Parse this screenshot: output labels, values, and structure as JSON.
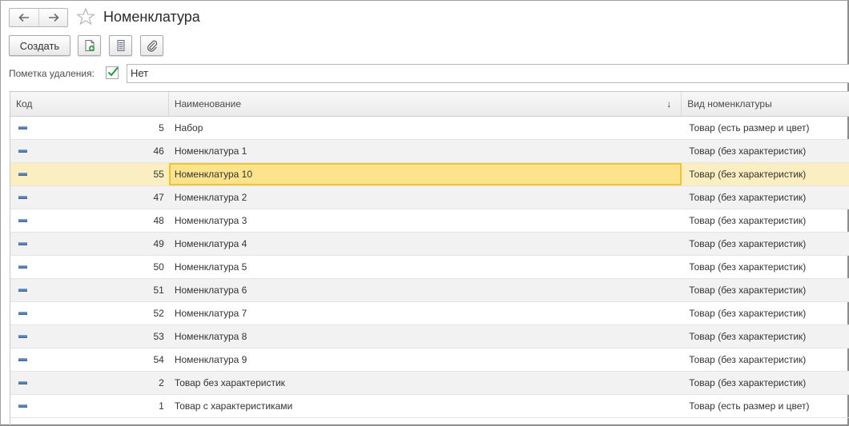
{
  "window": {
    "title": "Номенклатура"
  },
  "toolbar": {
    "create_label": "Создать",
    "icons": [
      "add-copy-icon",
      "list-view-icon",
      "attach-icon"
    ]
  },
  "filter": {
    "label": "Пометка удаления:",
    "checked": true,
    "value": "Нет"
  },
  "table": {
    "columns": [
      "Код",
      "Наименование",
      "Вид номенклатуры"
    ],
    "sort_column": "Наименование",
    "sort_direction": "descending-arrow",
    "rows": [
      {
        "code": "5",
        "name": "Набор",
        "type": "Товар (есть размер и цвет)"
      },
      {
        "code": "46",
        "name": "Номенклатура 1",
        "type": "Товар (без характеристик)"
      },
      {
        "code": "55",
        "name": "Номенклатура 10",
        "type": "Товар (без характеристик)"
      },
      {
        "code": "47",
        "name": "Номенклатура 2",
        "type": "Товар (без характеристик)"
      },
      {
        "code": "48",
        "name": "Номенклатура 3",
        "type": "Товар (без характеристик)"
      },
      {
        "code": "49",
        "name": "Номенклатура 4",
        "type": "Товар (без характеристик)"
      },
      {
        "code": "50",
        "name": "Номенклатура 5",
        "type": "Товар (без характеристик)"
      },
      {
        "code": "51",
        "name": "Номенклатура 6",
        "type": "Товар (без характеристик)"
      },
      {
        "code": "52",
        "name": "Номенклатура 7",
        "type": "Товар (без характеристик)"
      },
      {
        "code": "53",
        "name": "Номенклатура 8",
        "type": "Товар (без характеристик)"
      },
      {
        "code": "54",
        "name": "Номенклатура 9",
        "type": "Товар (без характеристик)"
      },
      {
        "code": "2",
        "name": "Товар без характеристик",
        "type": "Товар (без характеристик)"
      },
      {
        "code": "1",
        "name": "Товар с характеристиками",
        "type": "Товар (есть размер и цвет)"
      }
    ],
    "selected_row": 2
  },
  "colors": {
    "selected_row": "#fbeec0",
    "selected_cell": "#fde48c",
    "selected_cell_border": "#f1c232",
    "check": "#1f9c3a",
    "row_marker": "#5a82b8"
  }
}
